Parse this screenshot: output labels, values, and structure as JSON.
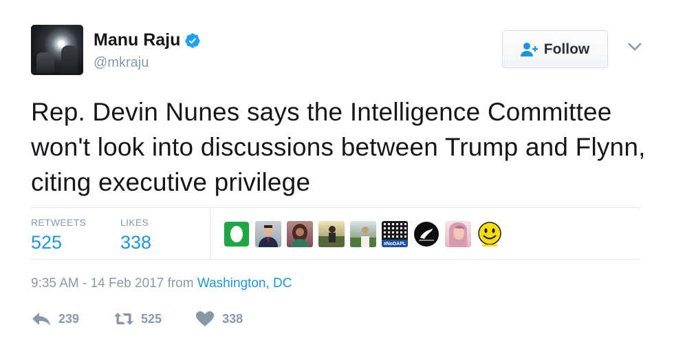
{
  "author": {
    "display_name": "Manu Raju",
    "handle": "@mkraju",
    "verified_icon": "verified-badge-icon",
    "avatar_icon": "avatar"
  },
  "follow_button": {
    "label": "Follow",
    "icon": "add-user-icon"
  },
  "menu_icon": "chevron-down-icon",
  "tweet": {
    "text": "Rep. Devin Nunes says the Intelligence Committee won't look into discussions between Trump and Flynn, citing executive privilege"
  },
  "stats": {
    "retweets_label": "RETWEETS",
    "retweets_value": "525",
    "likes_label": "LIKES",
    "likes_value": "338"
  },
  "likers": [
    {
      "name": "liker-avatar-1",
      "icon": "green-leaf-avatar"
    },
    {
      "name": "liker-avatar-2",
      "icon": "man-in-suit-avatar"
    },
    {
      "name": "liker-avatar-3",
      "icon": "woman-avatar"
    },
    {
      "name": "liker-avatar-4",
      "icon": "outdoor-photo-avatar"
    },
    {
      "name": "liker-avatar-5",
      "icon": "field-photo-avatar"
    },
    {
      "name": "liker-avatar-6",
      "icon": "nodapl-grid-avatar",
      "text": "#NoDAPL"
    },
    {
      "name": "liker-avatar-7",
      "icon": "heron-circle-avatar"
    },
    {
      "name": "liker-avatar-8",
      "icon": "woman-portrait-avatar"
    },
    {
      "name": "liker-avatar-9",
      "icon": "smiley-face-avatar"
    }
  ],
  "meta": {
    "time": "9:35 AM - 14 Feb 2017",
    "from_label": "from",
    "location": "Washington, DC"
  },
  "actions": {
    "reply_count": "239",
    "retweet_count": "525",
    "like_count": "338"
  },
  "colors": {
    "accent": "#1b95e0",
    "muted": "#8899a6",
    "text": "#14171a",
    "divider": "#e1e8ed"
  }
}
